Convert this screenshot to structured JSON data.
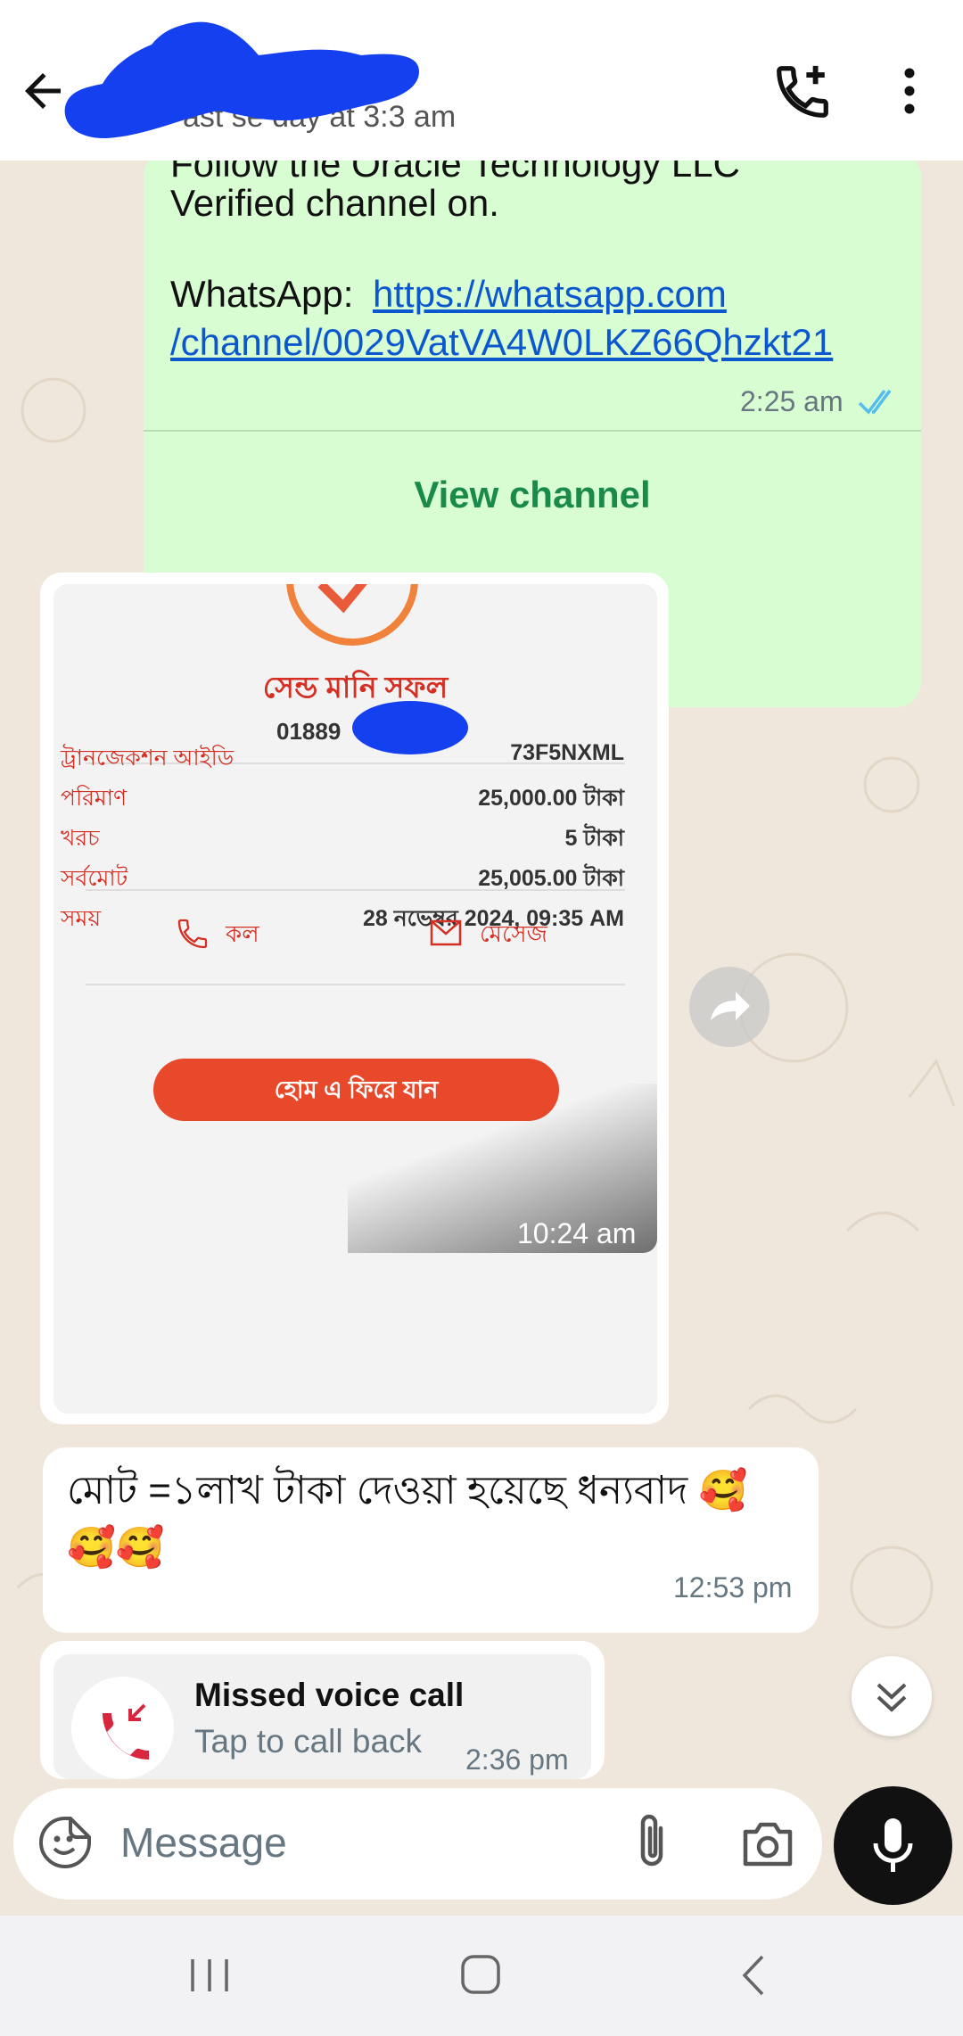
{
  "header": {
    "last_seen_fragment": "ast se          day at 3:3  am",
    "back_icon": "arrow-back-icon",
    "call_icon": "add-call-icon",
    "menu_icon": "more-vert-icon"
  },
  "channel_message": {
    "line1": "Follow the Oracle Technology LLC",
    "line2": "Verified channel on.",
    "whatsapp_label": "WhatsApp: ",
    "link_part1": "https://whatsapp.com",
    "link_part2": "/channel/0029VatVA4W0LKZ66Qhzkt21",
    "time": "2:25 am",
    "read_ticks": "double-check-icon",
    "view_channel": "View channel"
  },
  "receipt": {
    "title": "সেন্ড মানি সফল",
    "number": "01889",
    "rows": [
      {
        "label": "ট্রানজেকশন আইডি",
        "value": "73F5NXML"
      },
      {
        "label": "পরিমাণ",
        "value": "25,000.00 টাকা"
      },
      {
        "label": "খরচ",
        "value": "5 টাকা"
      },
      {
        "label": "সর্বমোট",
        "value": "25,005.00 টাকা"
      },
      {
        "label": "সময়",
        "value": "28 নভেম্বর 2024, 09:35 AM"
      }
    ],
    "call_label": "কল",
    "message_label": "মেসেজ",
    "home_button": "হোম এ ফিরে যান",
    "time": "10:24 am"
  },
  "text_message": {
    "text": "মোট =১লাখ টাকা দেওয়া হয়েছে ধন্যবাদ 🥰🥰🥰",
    "time": "12:53 pm"
  },
  "missed_call": {
    "title": "Missed voice call",
    "subtitle": "Tap to call back",
    "time": "2:36 pm"
  },
  "composer": {
    "placeholder": "Message"
  },
  "colors": {
    "accent_green": "#1a8a4a",
    "outgoing_bubble": "#d9fdd3",
    "chat_bg": "#efe7dc",
    "link_blue": "#0b57d0",
    "receipt_red": "#d52e22",
    "redaction_blue": "#1440f0"
  }
}
